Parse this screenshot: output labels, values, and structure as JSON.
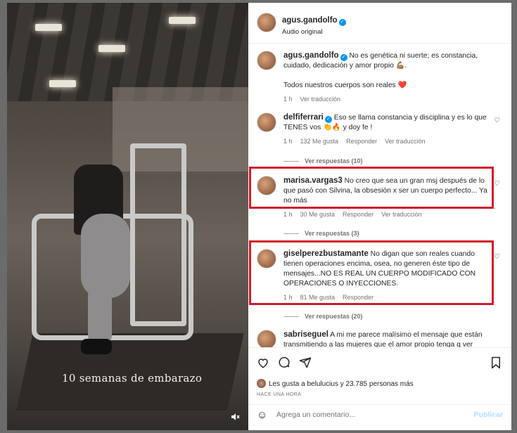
{
  "media": {
    "caption": "10 semanas de embarazo",
    "mute_icon": "speaker-muted-icon"
  },
  "header": {
    "username": "agus.gandolfo",
    "audio": "Audio original"
  },
  "post": {
    "username": "agus.gandolfo",
    "text": "No es genética ni suerte; es constancia, cuidado, dedicación y amor propio 💪🏽.",
    "text2": "Todos nuestros cuerpos son reales ❤️",
    "time": "1 h",
    "translate": "Ver traducción"
  },
  "comments": [
    {
      "username": "delfiferrari",
      "verified": true,
      "text": "Eso se llama constancia y disciplina y es lo que TENES vos 👏🔥 y doy fe !",
      "time": "1 h",
      "likes": "132 Me gusta",
      "reply": "Responder",
      "translate": "Ver traducción",
      "replies": "Ver respuestas (10)"
    },
    {
      "username": "marisa.vargas3",
      "text": "No creo que sea un gran msj después de lo que pasó con Silvina, la obsesión x ser un cuerpo perfecto... Ya no más",
      "time": "1 h",
      "likes": "30 Me gusta",
      "reply": "Responder",
      "translate": "Ver traducción",
      "replies": "Ver respuestas (3)"
    },
    {
      "username": "giselperezbustamante",
      "text": "No digan que son reales cuando tienen operaciones encima, osea, no generen éste tipo de mensajes...NO ES REAL UN CUERPO MODIFICADO CON OPERACIONES O INYECCIONES.",
      "time": "1 h",
      "likes": "81 Me gusta",
      "reply": "Responder",
      "replies": "Ver respuestas (20)"
    },
    {
      "username": "sabriseguel",
      "text": "A mi me parece malísimo el mensaje que están transmitiendo a las mujeres que el amor propio tenga q ver"
    }
  ],
  "actions": {
    "likes_text": "Les gusta a belulucius y 23.785 personas más",
    "when": "HACE UNA HORA",
    "comment_placeholder": "Agrega un comentario...",
    "publish": "Publicar"
  },
  "colors": {
    "highlight": "#d11a2a",
    "verified": "#0095f6",
    "publish_disabled": "#b3dbff"
  }
}
